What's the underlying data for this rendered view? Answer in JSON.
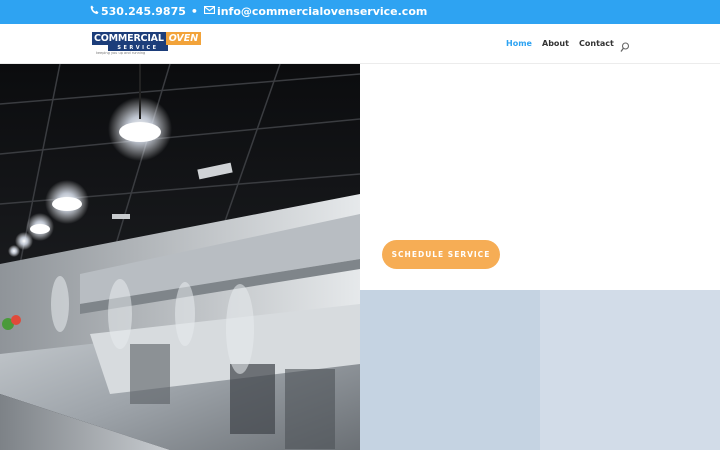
{
  "topbar": {
    "phone": "530.245.9875",
    "bullet": "•",
    "email": "info@commercialovenservice.com"
  },
  "logo": {
    "word1": "COMMERCIAL",
    "word2": "OVEN",
    "word3": "SERVICE",
    "tagline": "keeping you up and running"
  },
  "nav": {
    "items": [
      {
        "label": "Home",
        "active": true
      },
      {
        "label": "About"
      },
      {
        "label": "Contact"
      }
    ]
  },
  "hero": {
    "cta_label": "SCHEDULE SERVICE"
  },
  "colors": {
    "topbar": "#2ea3f2",
    "accent": "#2ea3f2",
    "cta": "#f6ad55",
    "brand_navy": "#1c3d7a",
    "brand_orange": "#f2a33a"
  }
}
